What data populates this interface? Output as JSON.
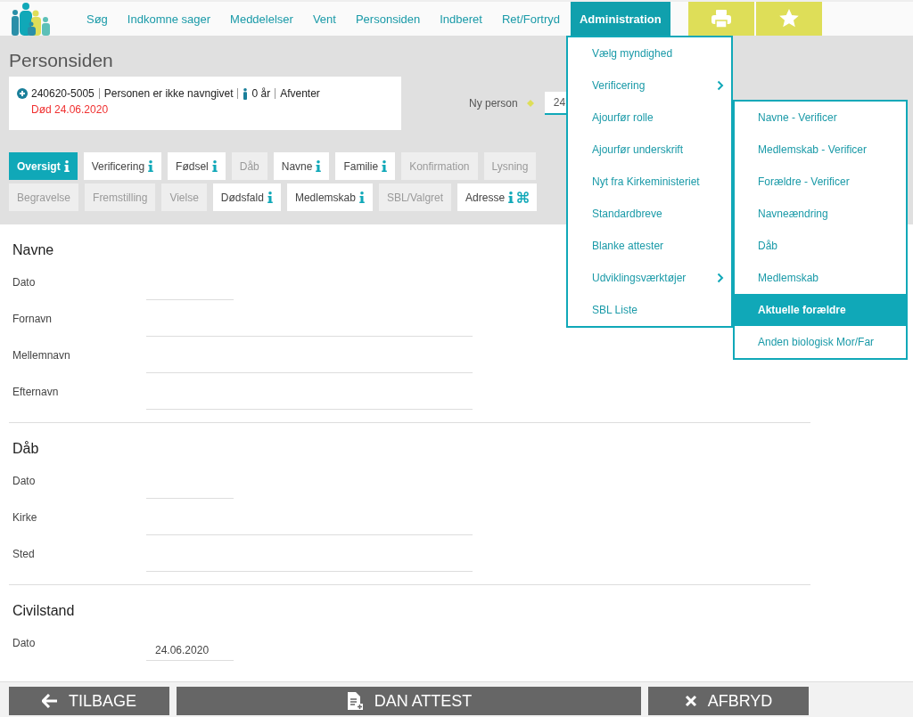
{
  "nav": [
    {
      "label": "Søg",
      "selected": false
    },
    {
      "label": "Indkomne sager",
      "selected": false
    },
    {
      "label": "Meddelelser",
      "selected": false
    },
    {
      "label": "Vent",
      "selected": false
    },
    {
      "label": "Personsiden",
      "selected": false
    },
    {
      "label": "Indberet",
      "selected": false
    },
    {
      "label": "Ret/Fortryd",
      "selected": false
    },
    {
      "label": "Administration",
      "selected": true
    }
  ],
  "page_title": "Personsiden",
  "person": {
    "cpr": "240620-5005",
    "name": "Personen er ikke navngivet",
    "age": "0 år",
    "status": "Afventer",
    "death": "Død 24.06.2020"
  },
  "new_person": {
    "label": "Ny person",
    "value": "24"
  },
  "tabs": [
    [
      {
        "label": "Oversigt",
        "kind": "info",
        "selected": true,
        "disabled": false
      },
      {
        "label": "Verificering",
        "kind": "info",
        "selected": false,
        "disabled": false
      },
      {
        "label": "Fødsel",
        "kind": "info",
        "selected": false,
        "disabled": false
      },
      {
        "label": "Dåb",
        "kind": "plain",
        "selected": false,
        "disabled": true
      },
      {
        "label": "Navne",
        "kind": "info",
        "selected": false,
        "disabled": false
      },
      {
        "label": "Familie",
        "kind": "info",
        "selected": false,
        "disabled": false
      },
      {
        "label": "Konfirmation",
        "kind": "plain",
        "selected": false,
        "disabled": true
      },
      {
        "label": "Lysning",
        "kind": "plain",
        "selected": false,
        "disabled": true
      }
    ],
    [
      {
        "label": "Begravelse",
        "kind": "plain",
        "selected": false,
        "disabled": true
      },
      {
        "label": "Fremstilling",
        "kind": "plain",
        "selected": false,
        "disabled": true
      },
      {
        "label": "Vielse",
        "kind": "plain",
        "selected": false,
        "disabled": true
      },
      {
        "label": "Dødsfald",
        "kind": "info",
        "selected": false,
        "disabled": false
      },
      {
        "label": "Medlemskab",
        "kind": "info",
        "selected": false,
        "disabled": false
      },
      {
        "label": "SBL/Valgret",
        "kind": "plain",
        "selected": false,
        "disabled": true
      },
      {
        "label": "Adresse",
        "kind": "info-command",
        "selected": false,
        "disabled": false
      }
    ]
  ],
  "sections": [
    {
      "title": "Navne",
      "fields": [
        {
          "label": "Dato",
          "kind": "date"
        },
        {
          "label": "Fornavn",
          "kind": "text"
        },
        {
          "label": "Mellemnavn",
          "kind": "text"
        },
        {
          "label": "Efternavn",
          "kind": "text"
        }
      ]
    },
    {
      "title": "Dåb",
      "fields": [
        {
          "label": "Dato",
          "kind": "date"
        },
        {
          "label": "Kirke",
          "kind": "text"
        },
        {
          "label": "Sted",
          "kind": "text"
        }
      ]
    },
    {
      "title": "Civilstand",
      "fields": [
        {
          "label": "Dato",
          "kind": "date",
          "value": "24.06.2020"
        }
      ]
    }
  ],
  "menu": [
    {
      "label": "Vælg myndighed",
      "submenu": false
    },
    {
      "label": "Verificering",
      "submenu": true,
      "children": [
        {
          "label": "Navne - Verificer",
          "selected": false
        },
        {
          "label": "Medlemskab - Verificer",
          "selected": false
        },
        {
          "label": "Forældre - Verificer",
          "selected": false
        },
        {
          "label": "Navneændring",
          "selected": false
        },
        {
          "label": "Dåb",
          "selected": false
        },
        {
          "label": "Medlemskab",
          "selected": false
        },
        {
          "label": "Aktuelle forældre",
          "selected": true
        },
        {
          "label": "Anden biologisk Mor/Far",
          "selected": false
        }
      ]
    },
    {
      "label": "Ajourfør rolle",
      "submenu": false
    },
    {
      "label": "Ajourfør underskrift",
      "submenu": false
    },
    {
      "label": "Nyt fra Kirkeministeriet",
      "submenu": false
    },
    {
      "label": "Standardbreve",
      "submenu": false
    },
    {
      "label": "Blanke attester",
      "submenu": false
    },
    {
      "label": "Udviklingsværktøjer",
      "submenu": true
    },
    {
      "label": "SBL Liste",
      "submenu": false
    }
  ],
  "footer": [
    {
      "label": "TILBAGE",
      "kind": "back"
    },
    {
      "label": "DAN ATTEST",
      "kind": "document"
    },
    {
      "label": "AFBRYD",
      "kind": "cancel"
    }
  ]
}
